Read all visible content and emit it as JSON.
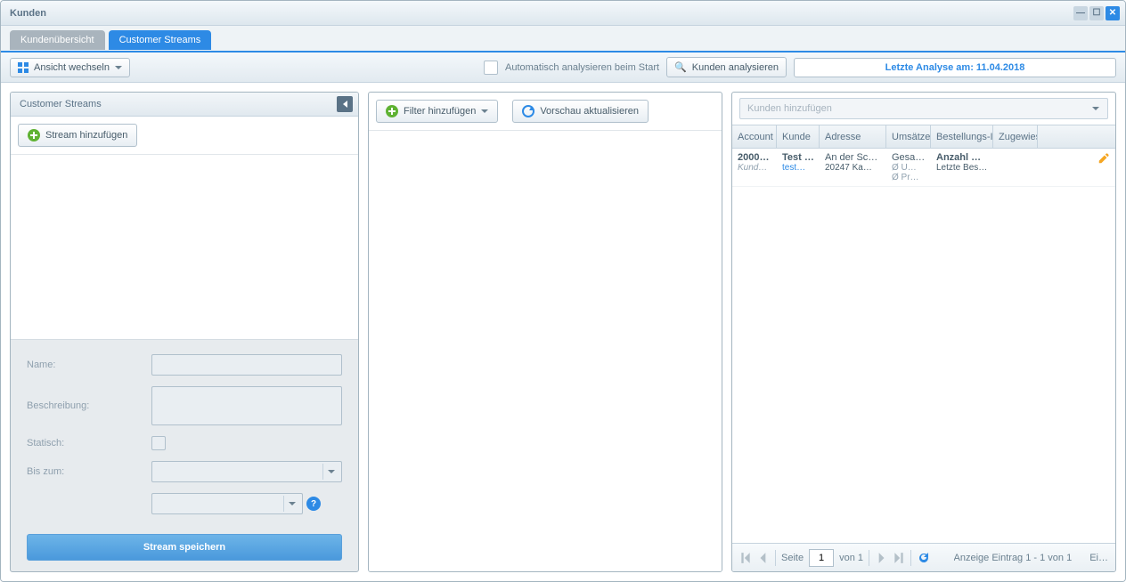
{
  "window": {
    "title": "Kunden"
  },
  "tabs": [
    {
      "label": "Kundenübersicht"
    },
    {
      "label": "Customer Streams"
    }
  ],
  "toolbar": {
    "view_switch": "Ansicht wechseln",
    "auto_analyze": "Automatisch analysieren beim Start",
    "analyze_customers": "Kunden analysieren",
    "last_analysis": "Letzte Analyse am: 11.04.2018"
  },
  "left": {
    "header": "Customer Streams",
    "add_stream": "Stream hinzufügen",
    "form": {
      "name_label": "Name:",
      "desc_label": "Beschreibung:",
      "static_label": "Statisch:",
      "until_label": "Bis zum:",
      "save": "Stream speichern"
    }
  },
  "mid": {
    "add_filter": "Filter hinzufügen",
    "refresh_preview": "Vorschau aktualisieren"
  },
  "right": {
    "combo_placeholder": "Kunden hinzufügen",
    "columns": {
      "account": "Account",
      "kunde": "Kunde",
      "adresse": "Adresse",
      "umsaetze": "Umsätze",
      "bestell": "Bestellungs-Informationen",
      "zugew": "Zugewiesen"
    },
    "rows": [
      {
        "account_l1": "2000…",
        "account_l2": "Kund…",
        "kunde_l1": "Test …",
        "kunde_l2": "test…",
        "adresse_l1": "An der Sc…",
        "adresse_l2": "20247 Ka…",
        "umsatz_l1": "Gesa…",
        "umsatz_l2": "Ø U…",
        "umsatz_l3": "Ø Pr…",
        "bestell_l1": "Anzahl B…",
        "bestell_l2": "Letzte Bes…"
      }
    ],
    "paging": {
      "page_label": "Seite",
      "current_page": "1",
      "of_label": "von 1",
      "info": "Anzeige Eintrag 1 - 1 von 1",
      "extra": "Ei…"
    }
  }
}
